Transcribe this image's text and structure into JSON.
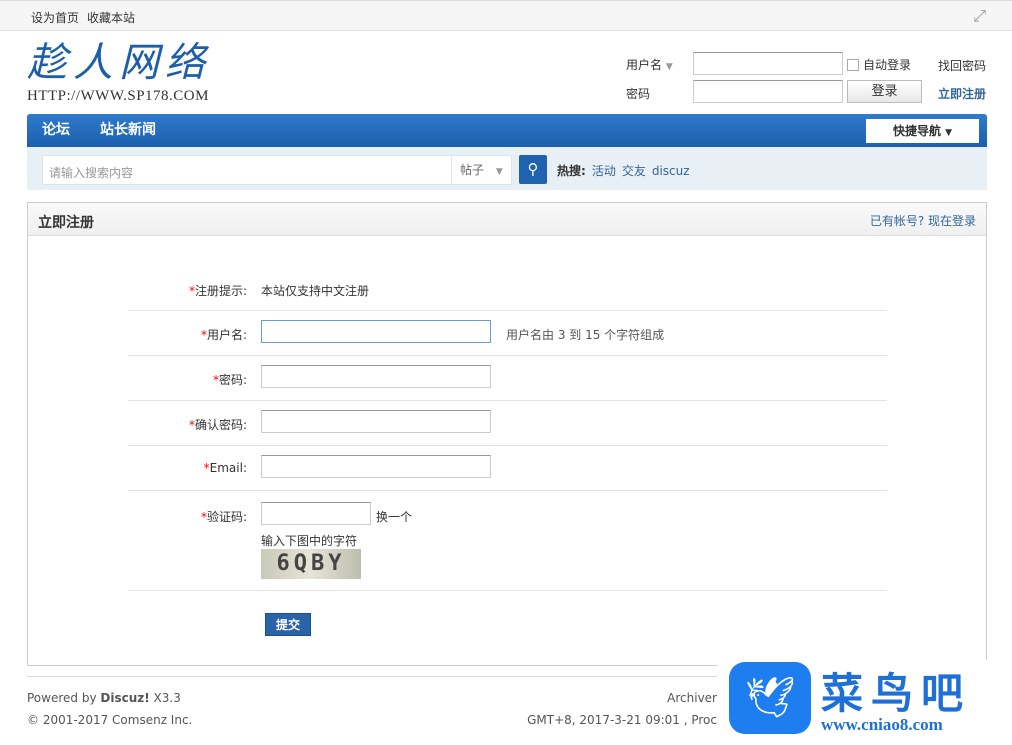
{
  "topbar": {
    "links": [
      "设为首页",
      "收藏本站"
    ]
  },
  "logo": {
    "text": "趁人网络",
    "url": "HTTP://WWW.SP178.COM"
  },
  "login": {
    "username_label": "用户名",
    "password_label": "密码",
    "auto_login": "自动登录",
    "forgot": "找回密码",
    "login_button": "登录",
    "register": "立即注册"
  },
  "nav": {
    "items": [
      "论坛",
      "站长新闻"
    ],
    "quick_nav": "快捷导航"
  },
  "search": {
    "placeholder": "请输入搜索内容",
    "type": "帖子",
    "hot_label": "热搜:",
    "hot": [
      "活动",
      "交友",
      "discuz"
    ]
  },
  "main": {
    "title": "立即注册",
    "login_link": "已有帐号? 现在登录",
    "form": {
      "hint_label": "注册提示:",
      "hint_text": "本站仅支持中文注册",
      "username_label": "用户名:",
      "username_tip": "用户名由 3 到 15 个字符组成",
      "password_label": "密码:",
      "confirm_label": "确认密码:",
      "email_label": "Email:",
      "captcha_label": "验证码:",
      "captcha_change": "换一个",
      "captcha_tip": "输入下图中的字符",
      "captcha_image": "6QBY",
      "submit": "提交"
    }
  },
  "footer": {
    "powered": "Powered by ",
    "brand": "Discuz!",
    "version": " X3.3",
    "copyright": "© 2001-2017 Comsenz Inc.",
    "archiver": "Archiver",
    "time": "GMT+8, 2017-3-21 09:01 , Proc"
  },
  "watermark": {
    "text": "菜鸟吧",
    "url": "www.cniao8.com"
  }
}
